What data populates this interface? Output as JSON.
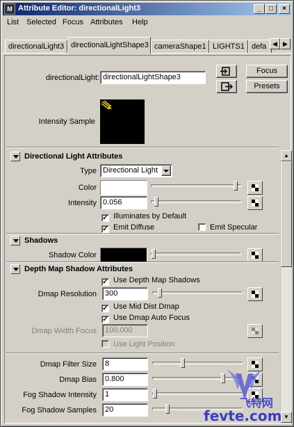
{
  "window": {
    "title": "Attribute Editor: directionalLight3",
    "controls": {
      "minimize": "_",
      "maximize": "□",
      "close": "×"
    }
  },
  "menu": [
    "List",
    "Selected",
    "Focus",
    "Attributes",
    "Help"
  ],
  "tabs": {
    "items": [
      "directionalLight3",
      "directionalLightShape3",
      "cameraShape1",
      "LIGHTS1",
      "defa"
    ],
    "active_index": 1,
    "prev_icon": "◀",
    "next_icon": "▶"
  },
  "header": {
    "name_label": "directionalLight:",
    "name_value": "directionalLightShape3",
    "focus_button": "Focus",
    "presets_button": "Presets",
    "intensity_sample_label": "Intensity Sample"
  },
  "directional_light": {
    "title": "Directional Light Attributes",
    "type_label": "Type",
    "type_value": "Directional Light",
    "color_label": "Color",
    "color_value": "#ffffff",
    "color_slider": 0.97,
    "intensity_label": "Intensity",
    "intensity_value": "0.056",
    "intensity_slider": 0.03,
    "illuminates_label": "Illuminates by Default",
    "illuminates_checked": true,
    "emit_diffuse_label": "Emit Diffuse",
    "emit_diffuse_checked": true,
    "emit_specular_label": "Emit Specular",
    "emit_specular_checked": false
  },
  "shadows": {
    "title": "Shadows",
    "shadow_color_label": "Shadow Color",
    "shadow_color_value": "#000000",
    "shadow_color_slider": 0.0
  },
  "depth_map": {
    "title": "Depth Map Shadow Attributes",
    "use_depth_label": "Use Depth Map Shadows",
    "use_depth_checked": true,
    "resolution_label": "Dmap Resolution",
    "resolution_value": "300",
    "resolution_slider": 0.06,
    "mid_dist_label": "Use Mid Dist Dmap",
    "mid_dist_checked": true,
    "auto_focus_label": "Use Dmap Auto Focus",
    "auto_focus_checked": true,
    "width_focus_label": "Dmap Width Focus",
    "width_focus_value": "100.000",
    "light_position_label": "Use Light Position",
    "light_position_checked": false,
    "filter_size_label": "Dmap Filter Size",
    "filter_size_value": "8",
    "filter_size_slider": 0.33,
    "bias_label": "Dmap Bias",
    "bias_value": "0.800",
    "bias_slider": 0.8,
    "fog_intensity_label": "Fog Shadow Intensity",
    "fog_intensity_value": "1",
    "fog_intensity_slider": 0.0,
    "fog_samples_label": "Fog Shadow Samples",
    "fog_samples_value": "20",
    "fog_samples_slider": 0.15
  },
  "watermark": {
    "text1": "飞特网",
    "text2": "fevte.com"
  },
  "colors": {
    "title_start": "#0a246a",
    "title_end": "#a6caf0",
    "panel": "#d4d0c8"
  }
}
